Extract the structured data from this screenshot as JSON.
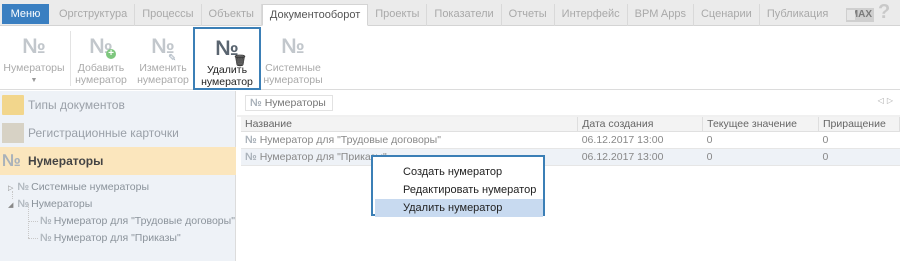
{
  "menubar": {
    "menu_label": "Меню",
    "tabs": [
      "Оргструктура",
      "Процессы",
      "Объекты",
      "Документооборот",
      "Проекты",
      "Показатели",
      "Отчеты",
      "Интерфейс",
      "BPM Apps",
      "Сценарии",
      "Публикация"
    ],
    "active_tab": "Документооборот",
    "max_label": "MAX",
    "help_label": "?"
  },
  "ribbon": {
    "numerators": "Нумераторы",
    "add": [
      "Добавить",
      "нумератор"
    ],
    "edit": [
      "Изменить",
      "нумератор"
    ],
    "delete": [
      "Удалить",
      "нумератор"
    ],
    "system": [
      "Системные",
      "нумераторы"
    ],
    "icon_glyph": "№"
  },
  "left": {
    "nav": [
      "Типы документов",
      "Регистрационные карточки",
      "Нумераторы"
    ],
    "tree": {
      "system": "Системные нумераторы",
      "numerators": "Нумераторы",
      "child1": "Нумератор для \"Трудовые договоры\"",
      "child2": "Нумератор для \"Приказы\""
    }
  },
  "right": {
    "tab_label": "Нумераторы",
    "columns": [
      "Название",
      "Дата создания",
      "Текущее значение",
      "Приращение"
    ],
    "rows": [
      [
        "Нумератор для \"Трудовые договоры\"",
        "06.12.2017 13:00",
        "0",
        "0"
      ],
      [
        "Нумератор для \"Приказы\"",
        "06.12.2017 13:00",
        "0",
        "0"
      ]
    ]
  },
  "context_menu": {
    "items": [
      "Создать нумератор",
      "Редактировать нумератор",
      "Удалить нумератор"
    ],
    "highlighted": "Удалить нумератор"
  },
  "colors": {
    "accent": "#3b7fb6",
    "menu_button": "#3a7fc1",
    "selected_nav": "#fbe6bd",
    "highlight": "#c8daf0"
  }
}
